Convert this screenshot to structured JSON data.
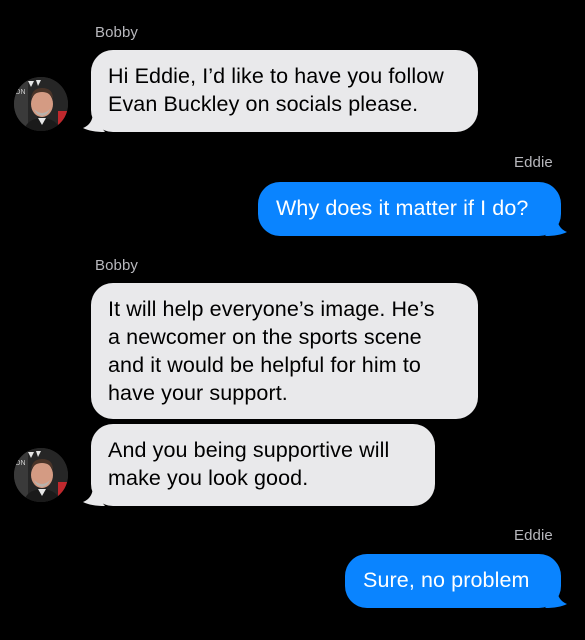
{
  "colors": {
    "background": "#000000",
    "incoming_bubble": "#e9e9eb",
    "outgoing_bubble": "#0a84ff",
    "sender_name": "#b8b8bd"
  },
  "conversation": {
    "messages": [
      {
        "sender": "Bobby",
        "direction": "incoming",
        "text": "Hi Eddie, I’d like to have you follow\nEvan Buckley on socials please."
      },
      {
        "sender": "Eddie",
        "direction": "outgoing",
        "text": "Why does it matter if I do?"
      },
      {
        "sender": "Bobby",
        "direction": "incoming",
        "text": "It will help everyone’s image. He’s\na newcomer on the sports scene\nand it would be helpful for him to\nhave your support."
      },
      {
        "sender": "Bobby",
        "direction": "incoming",
        "text": "And you being supportive will\nmake you look good."
      },
      {
        "sender": "Eddie",
        "direction": "outgoing",
        "text": "Sure, no problem"
      }
    ]
  },
  "avatar": {
    "icon": "contact-photo-icon",
    "backdrop_lettering": "ON"
  }
}
